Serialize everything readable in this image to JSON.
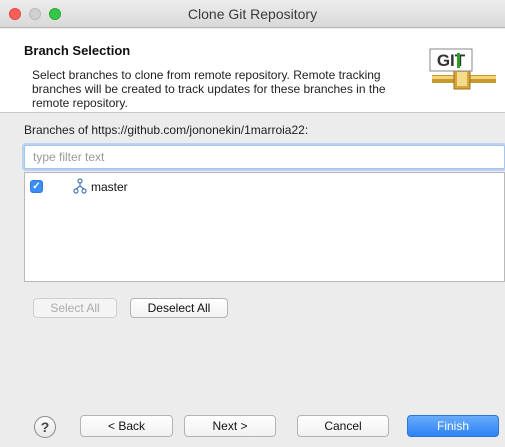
{
  "window": {
    "title": "Clone Git Repository"
  },
  "header": {
    "title": "Branch Selection",
    "description": "Select branches to clone from remote repository. Remote tracking branches will be created to track updates for these branches in the remote repository.",
    "logo_text": "GIT"
  },
  "branches": {
    "label": "Branches of https://github.com/jononekin/1marroia22:",
    "filter_placeholder": "type filter text",
    "filter_value": "",
    "items": [
      {
        "name": "master",
        "checked": true
      }
    ]
  },
  "selection_buttons": {
    "select_all": "Select All",
    "deselect_all": "Deselect All"
  },
  "footer": {
    "help": "?",
    "back": "< Back",
    "next": "Next >",
    "cancel": "Cancel",
    "finish": "Finish"
  },
  "colors": {
    "accent": "#2d83f5",
    "checkbox": "#3b8ef6",
    "close": "#fc5f57",
    "maximize": "#34c84a"
  }
}
